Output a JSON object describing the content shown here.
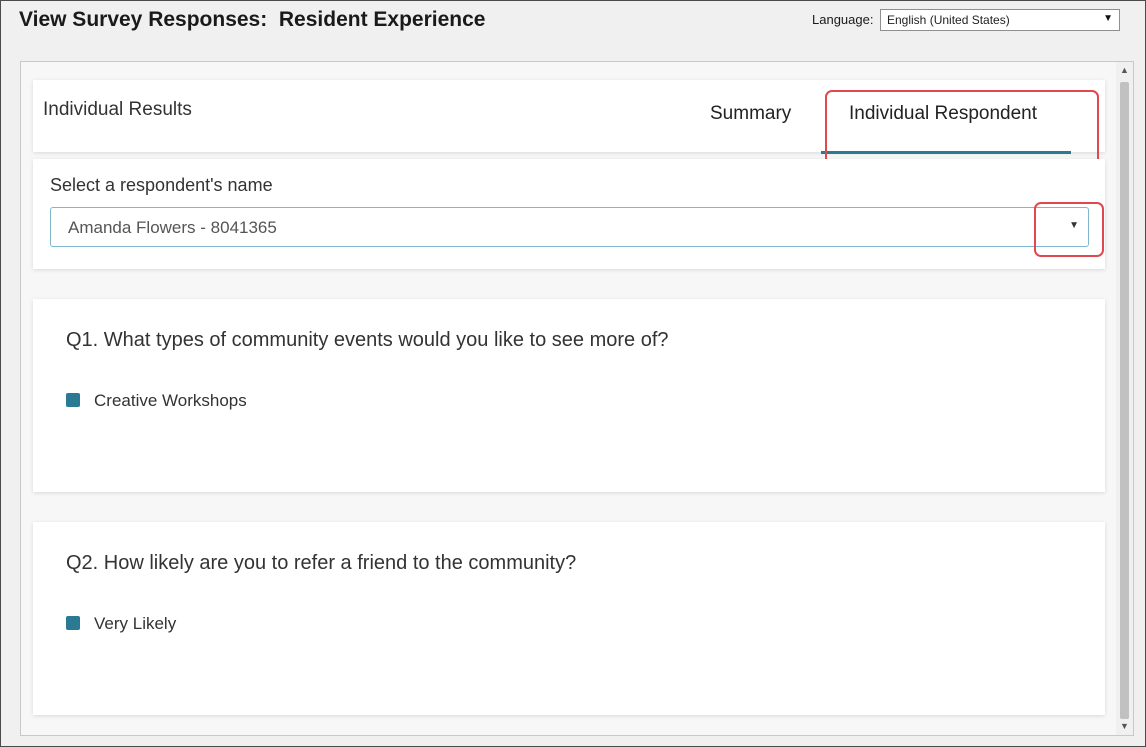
{
  "header": {
    "title": "View Survey Responses:  Resident Experience",
    "language_label": "Language:",
    "language_value": "English (United States)"
  },
  "results": {
    "title": "Individual Results",
    "tabs": [
      {
        "label": "Summary",
        "active": false
      },
      {
        "label": "Individual Respondent",
        "active": true
      }
    ]
  },
  "respondent": {
    "label": "Select a respondent's name",
    "selected": "Amanda Flowers - 8041365"
  },
  "questions": [
    {
      "text": "Q1. What types of community events would you like to see more of?",
      "answer": "Creative Workshops"
    },
    {
      "text": "Q2. How likely are you to refer a friend to the community?",
      "answer": "Very Likely"
    }
  ],
  "colors": {
    "accent": "#2a7a93",
    "highlight": "#e0484f"
  },
  "icons": {
    "dropdown": "chevron-down-icon",
    "scroll_up": "scroll-up-arrow-icon",
    "scroll_down": "scroll-down-arrow-icon"
  }
}
